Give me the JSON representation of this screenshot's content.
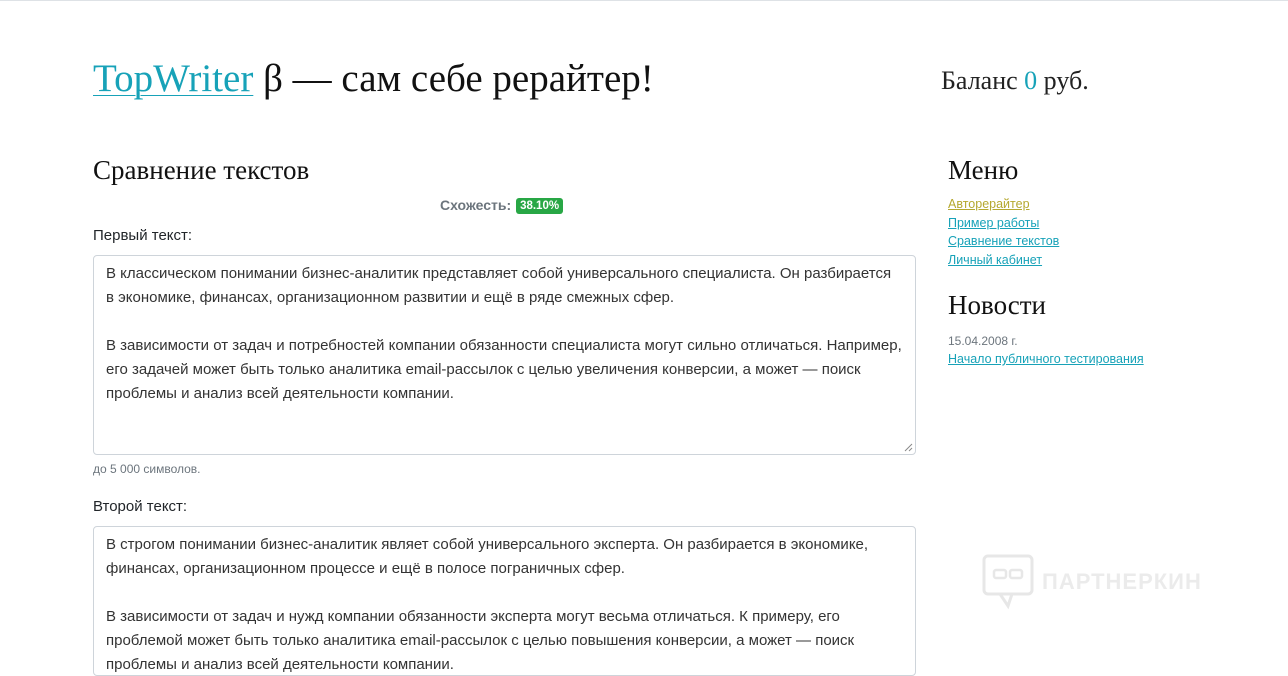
{
  "header": {
    "brand_link": "TopWriter",
    "brand_suffix": " β — сам себе рерайтер!",
    "balance_label": "Баланс ",
    "balance_amount": "0",
    "balance_currency": " руб."
  },
  "main": {
    "title": "Сравнение текстов",
    "similarity_label": "Схожесть:",
    "similarity_value": "38.10%",
    "first_label": "Первый текст:",
    "first_text": [
      "В классическом понимании бизнес-аналитик представляет собой универсального специалиста. Он разбирается в экономике, финансах, организационном развитии и ещё в ряде смежных сфер.",
      "В зависимости от задач и потребностей компании обязанности специалиста могут сильно отличаться. Например, его задачей может быть только аналитика email-рассылок с целью увеличения конверсии, а может — поиск проблемы и анализ всей деятельности компании."
    ],
    "hint": "до 5 000 символов.",
    "second_label": "Второй текст:",
    "second_text": [
      "В строгом понимании бизнес-аналитик являет собой универсального эксперта. Он разбирается в экономике, финансах, организационном процессе и ещё в полосе пограничных сфер.",
      "В зависимости от задач и нужд компании обязанности эксперта могут весьма отличаться. К примеру, его проблемой может быть только аналитика email-рассылок с целью повышения конверсии, а может — поиск проблемы и анализ всей деятельности компании."
    ]
  },
  "sidebar": {
    "menu_title": "Меню",
    "menu_items": [
      "Авторерайтер",
      "Пример работы",
      "Сравнение текстов",
      "Личный кабинет"
    ],
    "news_title": "Новости",
    "news_date": "15.04.2008 г.",
    "news_link": "Начало публичного тестирования"
  },
  "watermark": "ПАРТНЕРКИН",
  "colors": {
    "accent": "#17a2b8",
    "active_menu": "#b5a82f",
    "badge": "#28a745"
  }
}
